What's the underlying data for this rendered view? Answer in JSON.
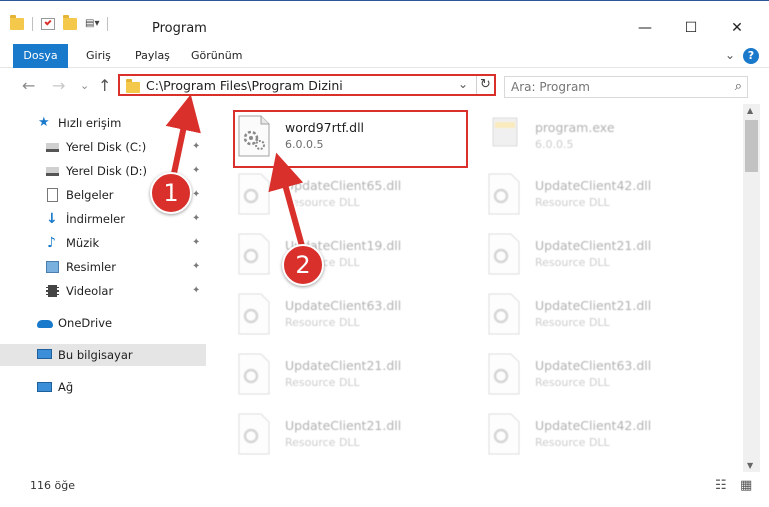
{
  "window": {
    "title": "Program",
    "minimize": "—",
    "maximize": "☐",
    "close": "✕"
  },
  "ribbon": {
    "tabs": [
      "Dosya",
      "Giriş",
      "Paylaş",
      "Görünüm"
    ],
    "help": "?",
    "expand": "⌄"
  },
  "nav": {
    "back": "←",
    "forward": "→",
    "recent": "⌄",
    "up": "↑",
    "address": "C:\\Program Files\\Program Dizini",
    "dropdown": "⌄",
    "refresh": "↻",
    "search_placeholder": "Ara: Program",
    "search_icon": "⌕"
  },
  "sidebar": {
    "items": [
      {
        "label": "Hızlı erişim",
        "icon": "star-icon"
      },
      {
        "label": "Yerel Disk (C:)",
        "icon": "drive-icon",
        "pinned": true
      },
      {
        "label": "Yerel Disk (D:)",
        "icon": "drive-icon",
        "pinned": true
      },
      {
        "label": "Belgeler",
        "icon": "document-icon",
        "pinned": true
      },
      {
        "label": "İndirmeler",
        "icon": "download-icon",
        "pinned": true
      },
      {
        "label": "Müzik",
        "icon": "music-icon",
        "pinned": true
      },
      {
        "label": "Resimler",
        "icon": "pictures-icon",
        "pinned": true
      },
      {
        "label": "Videolar",
        "icon": "video-icon",
        "pinned": true
      },
      {
        "label": "OneDrive",
        "icon": "cloud-icon"
      },
      {
        "label": "Bu bilgisayar",
        "icon": "computer-icon",
        "selected": true
      },
      {
        "label": "Ağ",
        "icon": "network-icon"
      }
    ],
    "pin_glyph": "📌"
  },
  "files": [
    {
      "name": "word97rtf.dll",
      "sub": "6.0.0.5",
      "highlighted": true
    },
    {
      "name": "program.exe",
      "sub": "6.0.0.5"
    },
    {
      "name": "UpdateClient65.dll",
      "sub": "Resource DLL"
    },
    {
      "name": "UpdateClient42.dll",
      "sub": "Resource DLL"
    },
    {
      "name": "UpdateClient19.dll",
      "sub": "Resource DLL"
    },
    {
      "name": "UpdateClient21.dll",
      "sub": "Resource DLL"
    },
    {
      "name": "UpdateClient63.dll",
      "sub": "Resource DLL"
    },
    {
      "name": "UpdateClient21.dll",
      "sub": "Resource DLL"
    },
    {
      "name": "UpdateClient21.dll",
      "sub": "Resource DLL"
    },
    {
      "name": "UpdateClient63.dll",
      "sub": "Resource DLL"
    },
    {
      "name": "UpdateClient21.dll",
      "sub": "Resource DLL"
    },
    {
      "name": "UpdateClient42.dll",
      "sub": "Resource DLL"
    }
  ],
  "status": {
    "count": "116 öğe",
    "details_view": "☷",
    "tiles_view": "▦"
  },
  "callouts": {
    "one": "1",
    "two": "2"
  },
  "colors": {
    "accent": "#1979ca",
    "highlight": "#d9302c",
    "selected_bg": "#e5e5e5"
  }
}
